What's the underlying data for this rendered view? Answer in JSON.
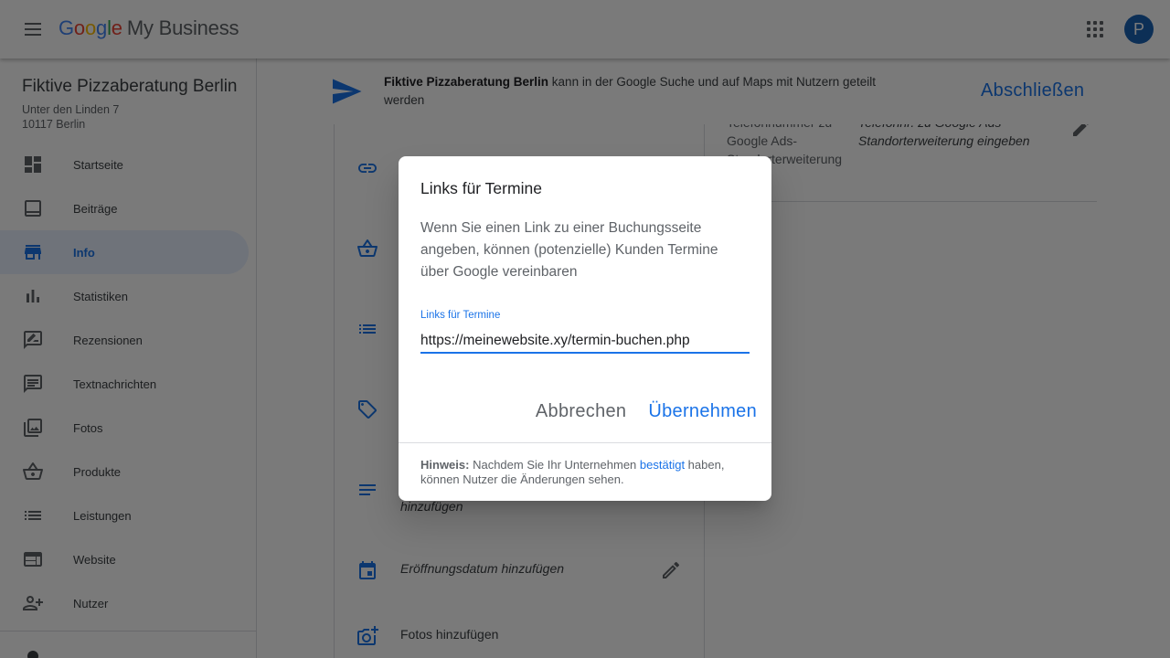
{
  "appbar": {
    "logo_google": [
      "G",
      "o",
      "o",
      "g",
      "l",
      "e"
    ],
    "logo_product": "My Business",
    "avatar_initial": "P"
  },
  "sidebar": {
    "business_name": "Fiktive Pizzaberatung Berlin",
    "address_line1": "Unter den Linden 7",
    "address_line2": "10117 Berlin",
    "items": [
      {
        "label": "Startseite",
        "icon": "dashboard-icon",
        "active": false
      },
      {
        "label": "Beiträge",
        "icon": "posts-icon",
        "active": false
      },
      {
        "label": "Info",
        "icon": "storefront-icon",
        "active": true
      },
      {
        "label": "Statistiken",
        "icon": "bar-chart-icon",
        "active": false
      },
      {
        "label": "Rezensionen",
        "icon": "rate-review-icon",
        "active": false
      },
      {
        "label": "Textnachrichten",
        "icon": "message-icon",
        "active": false
      },
      {
        "label": "Fotos",
        "icon": "photo-library-icon",
        "active": false
      },
      {
        "label": "Produkte",
        "icon": "basket-icon",
        "active": false
      },
      {
        "label": "Leistungen",
        "icon": "list-icon",
        "active": false
      },
      {
        "label": "Website",
        "icon": "web-icon",
        "active": false
      },
      {
        "label": "Nutzer",
        "icon": "person-add-icon",
        "active": false
      }
    ]
  },
  "banner": {
    "business_name": "Fiktive Pizzaberatung Berlin",
    "text": " kann in der Google Suche und auf Maps mit Nutzern geteilt werden",
    "finish_label": "Abschließen"
  },
  "info_rows": {
    "description_tail": "hinzufügen",
    "opening_date": "Eröffnungsdatum hinzufügen",
    "photos": "Fotos hinzufügen",
    "phone_label": "Telefonnummer zu Google Ads-Standorterweiterung",
    "phone_value": "Telefonnr. zu Google Ads-Standorterweiterung eingeben"
  },
  "dialog": {
    "title": "Links für Termine",
    "body": "Wenn Sie einen Link zu einer Buchungsseite angeben, können (potenzielle) Kunden Termine über Google vereinbaren",
    "field_label": "Links für Termine",
    "field_value": "https://meinewebsite.xy/termin-buchen.php",
    "cancel_label": "Abbrechen",
    "apply_label": "Übernehmen",
    "note_bold": "Hinweis:",
    "note_before_link": " Nachdem Sie Ihr Unternehmen ",
    "note_link": "bestätigt",
    "note_after_link": " haben, können Nutzer die Änderungen sehen."
  },
  "colors": {
    "accent": "#1a73e8",
    "active_nav_bg": "#e8f0fe",
    "scrim": "rgba(0,0,0,0.52)"
  }
}
